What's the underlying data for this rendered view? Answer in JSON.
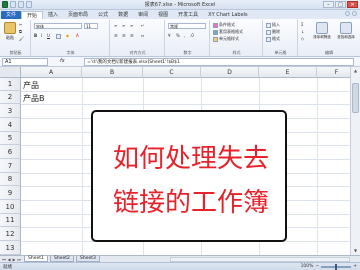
{
  "window": {
    "title": "报表67.xlsx - Microsoft Excel",
    "minimize": "–",
    "maximize": "□",
    "close": "✕"
  },
  "tabs": [
    "文件",
    "开始",
    "插入",
    "页面布局",
    "公式",
    "数据",
    "审阅",
    "视图",
    "开发工具",
    "XY Chart Labels"
  ],
  "ribbon": {
    "paste_label": "粘贴",
    "clipboard_label": "剪贴板",
    "font_name": "宋体",
    "font_size": "11",
    "font_label": "字体",
    "align_label": "对齐方式",
    "number_format": "常规",
    "number_label": "数字",
    "cond_format": "条件格式",
    "table_format": "套用表格格式",
    "cell_style": "单元格样式",
    "style_label": "样式",
    "insert": "插入",
    "delete": "删除",
    "format": "格式",
    "cells_label": "单元格",
    "sort_filter": "排序和筛选",
    "find_select": "查找和选择",
    "edit_label": "编辑"
  },
  "formula_bar": {
    "name_box": "A1",
    "fx": "fx",
    "formula": "='d:\\我的文档\\[新建报表.xlsx]Sheet1'!$B$1"
  },
  "grid": {
    "columns": [
      "A",
      "B",
      "C",
      "D",
      "E",
      "F"
    ],
    "rows": [
      "1",
      "2",
      "3",
      "4",
      "5",
      "6",
      "7",
      "8",
      "9",
      "10",
      "11",
      "12",
      "13"
    ],
    "cells": {
      "A1": "产品",
      "A2": "产品B"
    }
  },
  "overlay": {
    "line1": "如何处理失去",
    "line2": "链接的工作簿"
  },
  "sheets": [
    "Sheet1",
    "Sheet2",
    "Sheet3"
  ],
  "status": {
    "ready": "就绪",
    "zoom": "100%"
  },
  "colors": {
    "accent": "#2a6bbf",
    "overlay_text": "#e8222a",
    "excel_green": "#1f7a3e"
  }
}
